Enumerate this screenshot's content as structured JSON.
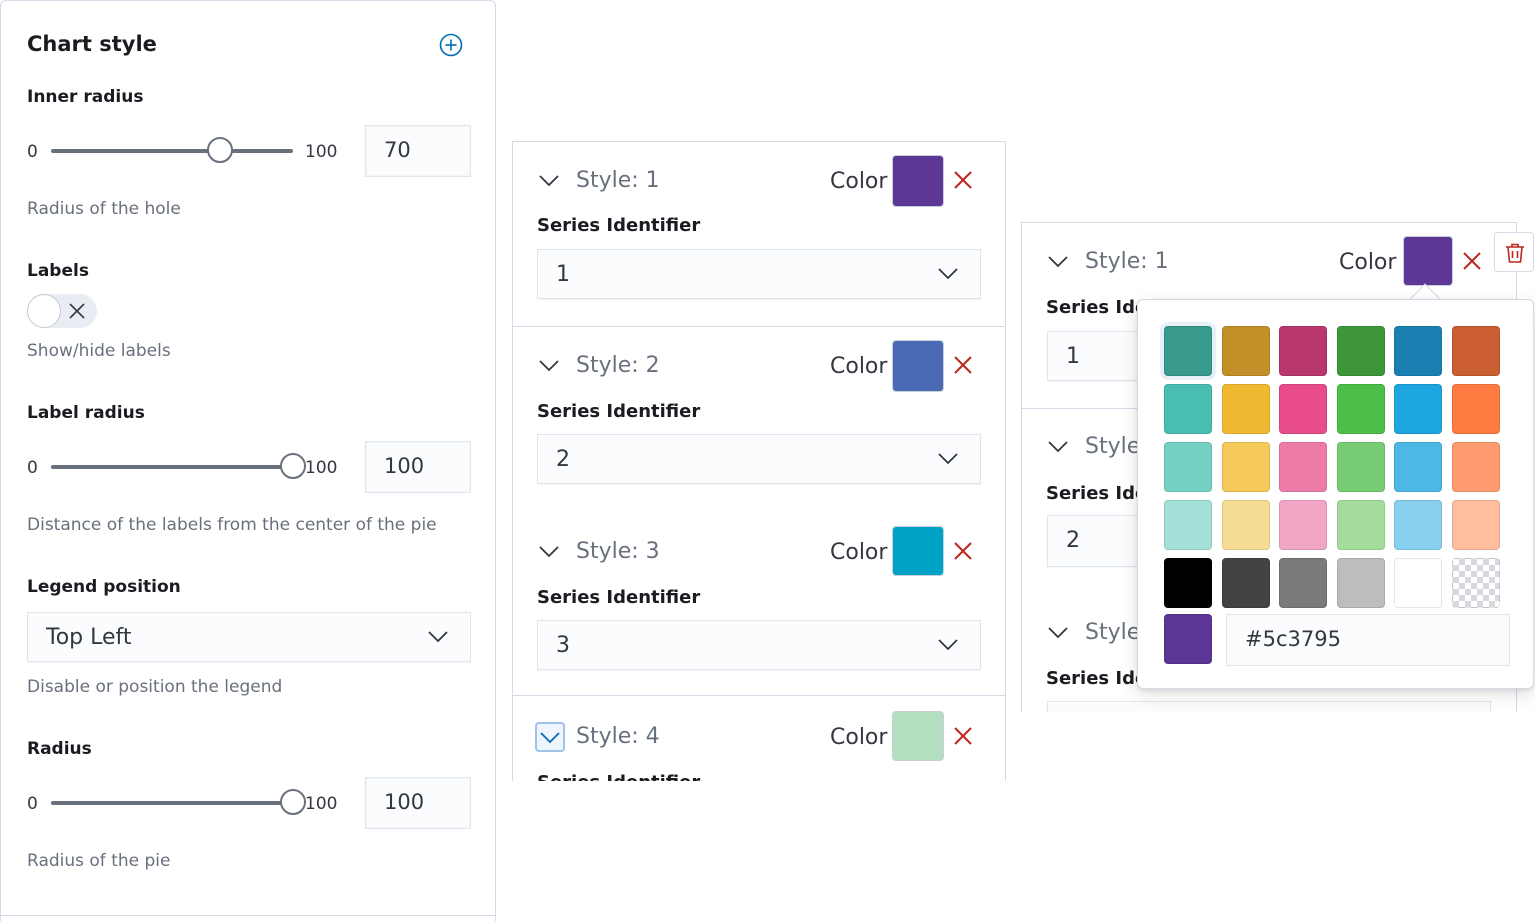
{
  "chart_style": {
    "title": "Chart style",
    "inner_radius": {
      "label": "Inner radius",
      "min": "0",
      "max": "100",
      "value": "70",
      "fraction": 0.7,
      "help": "Radius of the hole"
    },
    "labels": {
      "label": "Labels",
      "help": "Show/hide labels",
      "enabled": false
    },
    "label_radius": {
      "label": "Label radius",
      "min": "0",
      "max": "100",
      "value": "100",
      "fraction": 1.0,
      "help": "Distance of the labels from the center of the pie"
    },
    "legend_position": {
      "label": "Legend position",
      "value": "Top Left",
      "help": "Disable or position the legend"
    },
    "radius": {
      "label": "Radius",
      "min": "0",
      "max": "100",
      "value": "100",
      "fraction": 1.0,
      "help": "Radius of the pie"
    }
  },
  "series_styles": {
    "color_label": "Color",
    "series_identifier_label": "Series Identifier",
    "items": [
      {
        "name": "Style: 1",
        "color": "#5c3795",
        "series": "1"
      },
      {
        "name": "Style: 2",
        "color": "#4a6bb3",
        "series": "2"
      },
      {
        "name": "Style: 3",
        "color": "#00a3c8",
        "series": "3"
      },
      {
        "name": "Style: 4",
        "color": "#b3dfc1",
        "series": "Series Identifier"
      }
    ]
  },
  "right_panel": {
    "style_name": "Style: 1",
    "color_label": "Color",
    "color": "#5c3795",
    "series_label_partial": "Series Ide",
    "style_partial": "Style",
    "series_values": [
      "1",
      "2"
    ]
  },
  "color_picker": {
    "palette": [
      [
        "#379a8d",
        "#c19028",
        "#b8386e",
        "#3d9738",
        "#1a80b1",
        "#ca5d32"
      ],
      [
        "#49bfb1",
        "#f1b932",
        "#e84d8a",
        "#4cbf49",
        "#1da6df",
        "#fd7a40"
      ],
      [
        "#75d0c4",
        "#f5ca5a",
        "#ec7ca7",
        "#78cc73",
        "#4cb8e6",
        "#fd9b6f"
      ],
      [
        "#a2e0d8",
        "#f7dc94",
        "#f1a6c5",
        "#a4dc9c",
        "#87d0ef",
        "#ffbea0"
      ],
      [
        "#000000",
        "#434343",
        "#7a7a7a",
        "#bdbdbd",
        "#ffffff",
        "transparent"
      ]
    ],
    "current_hex": "#5c3795"
  },
  "colors": {
    "accent": "#006bb8",
    "danger": "#bd271e"
  }
}
